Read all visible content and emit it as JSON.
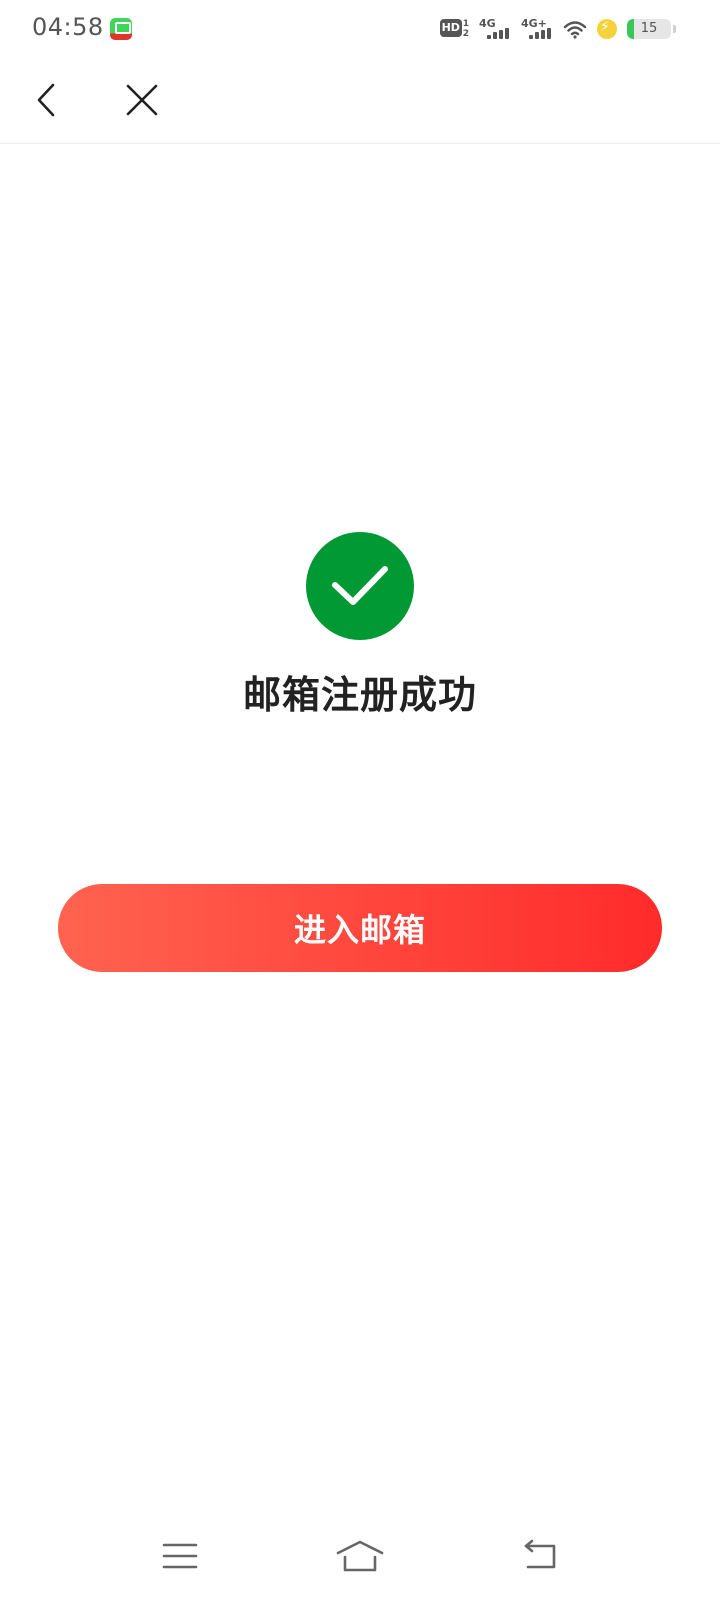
{
  "status_bar": {
    "time": "04:58",
    "app_badge_icon": "app-notification-icon",
    "hd": "HD",
    "hd_sub_top": "1",
    "hd_sub_bottom": "2",
    "signal1_label": "4G",
    "signal2_label": "4G+",
    "battery_level": "15",
    "battery_color": "#39c75a",
    "charging_color": "#f5d23a"
  },
  "nav": {
    "back_icon": "chevron-left-icon",
    "close_icon": "close-icon"
  },
  "main": {
    "success_icon": "checkmark-circle-icon",
    "success_color": "#009933",
    "title": "邮箱注册成功",
    "enter_button_label": "进入邮箱",
    "button_gradient": [
      "#ff6350",
      "#ff2b2b"
    ]
  },
  "system_nav": {
    "menu_icon": "menu-icon",
    "home_icon": "home-icon",
    "back_icon": "back-icon"
  }
}
